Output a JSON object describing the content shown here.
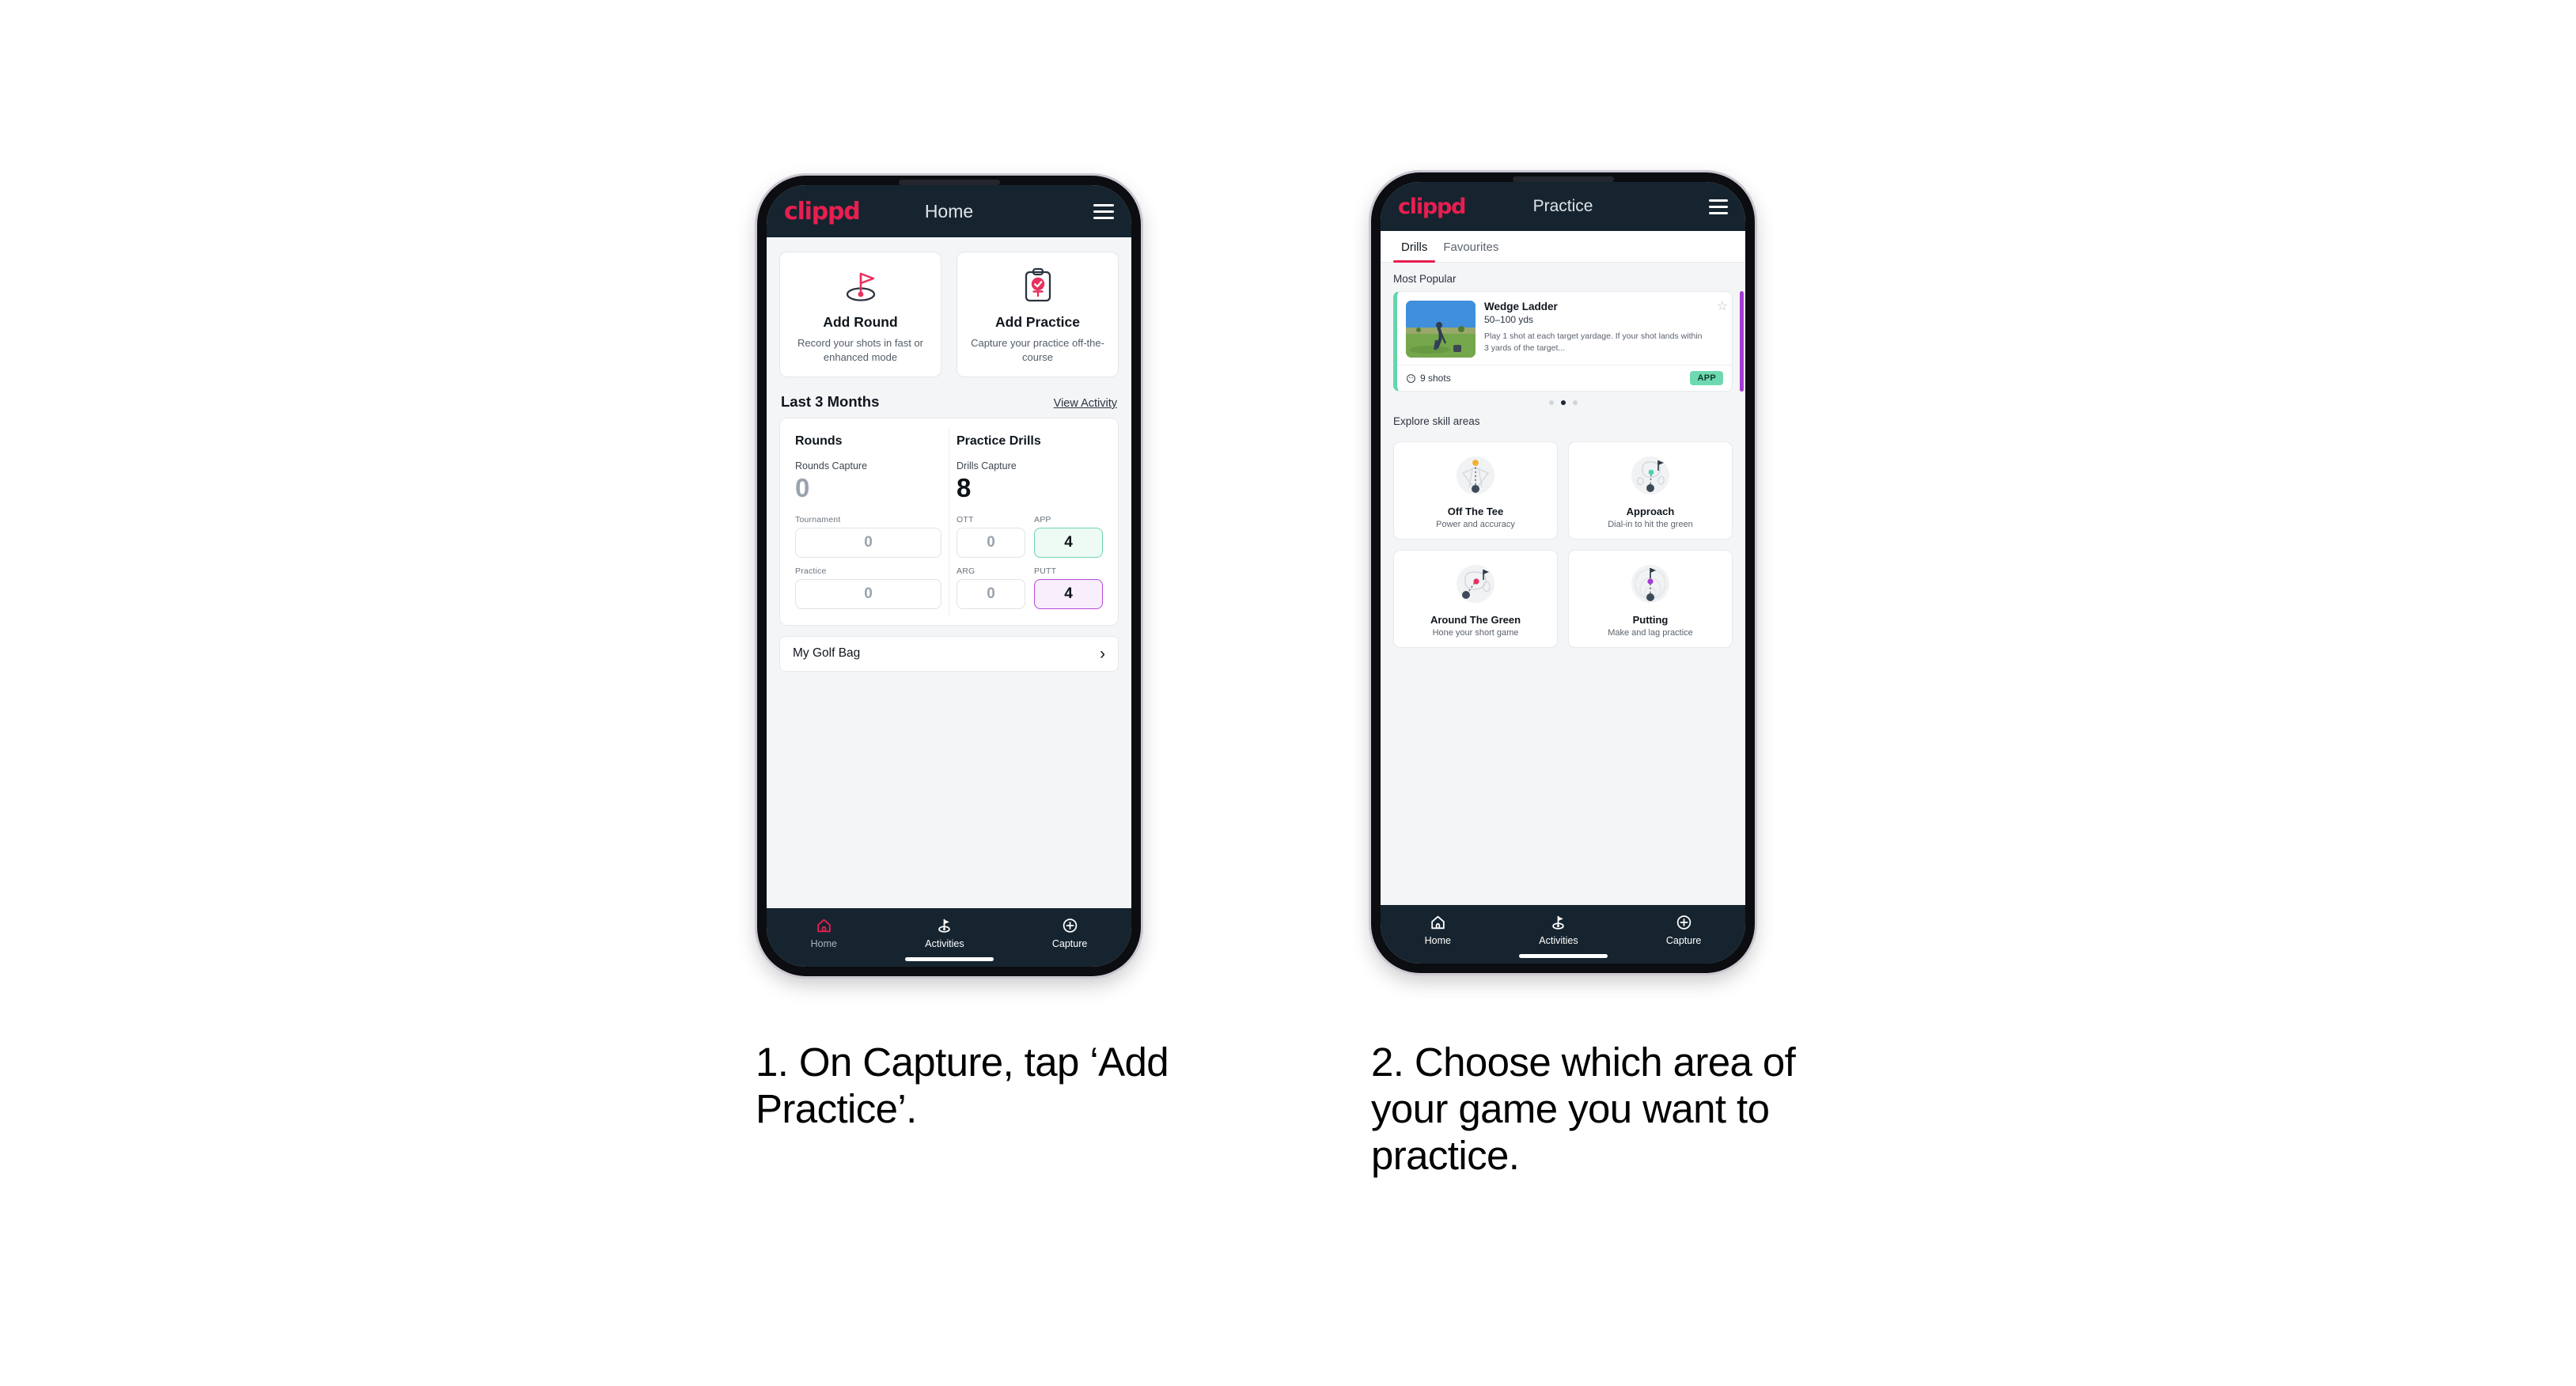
{
  "phone1": {
    "appbar": {
      "brand": "clippd",
      "title": "Home",
      "menu_icon": "hamburger-icon"
    },
    "actions": [
      {
        "icon": "golf-flag-icon",
        "title": "Add Round",
        "sub": "Record your shots in fast or enhanced mode"
      },
      {
        "icon": "clipboard-check-icon",
        "title": "Add Practice",
        "sub": "Capture your practice off-the-course"
      }
    ],
    "section": {
      "title": "Last 3 Months",
      "link": "View Activity"
    },
    "rounds": {
      "heading": "Rounds",
      "capture_label": "Rounds Capture",
      "capture_value": "0",
      "tiles": [
        {
          "label": "Tournament",
          "value": "0",
          "state": "empty"
        },
        {
          "label": "Practice",
          "value": "0",
          "state": "empty"
        }
      ]
    },
    "drills": {
      "heading": "Practice Drills",
      "capture_label": "Drills Capture",
      "capture_value": "8",
      "tiles": [
        {
          "label": "OTT",
          "value": "0",
          "state": "empty"
        },
        {
          "label": "APP",
          "value": "4",
          "state": "green"
        },
        {
          "label": "ARG",
          "value": "0",
          "state": "empty"
        },
        {
          "label": "PUTT",
          "value": "4",
          "state": "purple"
        }
      ]
    },
    "bag": {
      "label": "My Golf Bag",
      "chevron": "chevron-right-icon"
    },
    "nav": [
      {
        "icon": "home-icon",
        "label": "Home",
        "active": true
      },
      {
        "icon": "activities-golf-icon",
        "label": "Activities",
        "active": false
      },
      {
        "icon": "capture-plus-icon",
        "label": "Capture",
        "active": false
      }
    ]
  },
  "phone2": {
    "appbar": {
      "brand": "clippd",
      "title": "Practice",
      "menu_icon": "hamburger-icon"
    },
    "tabs": [
      {
        "label": "Drills",
        "active": true
      },
      {
        "label": "Favourites",
        "active": false
      }
    ],
    "most_popular_label": "Most Popular",
    "drill": {
      "title": "Wedge Ladder",
      "yardage": "50–100 yds",
      "description": "Play 1 shot at each target yardage. If your shot lands within 3 yards of the target...",
      "shots": "9 shots",
      "badge": "APP",
      "star_icon": "star-outline-icon",
      "clock_icon": "clock-icon",
      "thumbnail": "golfer-photo"
    },
    "carousel_dots": {
      "count": 3,
      "active_index": 1
    },
    "explore_label": "Explore skill areas",
    "skills": [
      {
        "icon": "off-the-tee-icon",
        "title": "Off The Tee",
        "sub": "Power and accuracy"
      },
      {
        "icon": "approach-icon",
        "title": "Approach",
        "sub": "Dial-in to hit the green"
      },
      {
        "icon": "around-the-green-icon",
        "title": "Around The Green",
        "sub": "Hone your short game"
      },
      {
        "icon": "putting-icon",
        "title": "Putting",
        "sub": "Make and lag practice"
      }
    ],
    "nav": [
      {
        "icon": "home-icon",
        "label": "Home",
        "active": false
      },
      {
        "icon": "activities-golf-icon",
        "label": "Activities",
        "active": false
      },
      {
        "icon": "capture-plus-icon",
        "label": "Capture",
        "active": false
      }
    ]
  },
  "captions": {
    "one": "1. On Capture, tap ‘Add Practice’.",
    "two": "2. Choose which area of your game you want to practice."
  },
  "colors": {
    "brand_pink": "#e81e50",
    "dark_navy": "#16242f",
    "app_green": "#6ed9b0",
    "putt_purple": "#b44ad6",
    "page_bg": "#f4f5f7"
  }
}
